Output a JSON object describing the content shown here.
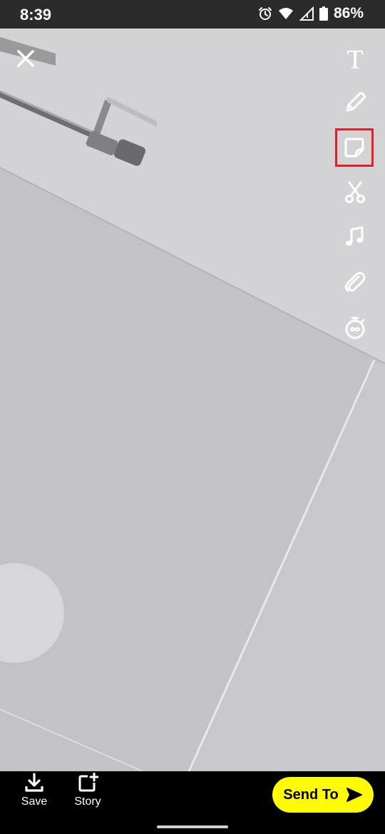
{
  "status_bar": {
    "time": "8:39",
    "battery_percent": "86%",
    "icons": [
      "alarm-icon",
      "wifi-icon",
      "signal-icon",
      "battery-icon"
    ]
  },
  "editor": {
    "close_icon": "close-icon",
    "tools": [
      {
        "name": "text-tool",
        "icon": "text-icon",
        "glyph": "T",
        "highlighted": false
      },
      {
        "name": "draw-tool",
        "icon": "pencil-icon",
        "highlighted": false
      },
      {
        "name": "sticker-tool",
        "icon": "sticker-icon",
        "highlighted": true
      },
      {
        "name": "scissors-tool",
        "icon": "scissors-icon",
        "highlighted": false
      },
      {
        "name": "music-tool",
        "icon": "music-note-icon",
        "highlighted": false
      },
      {
        "name": "attachment-tool",
        "icon": "paperclip-icon",
        "highlighted": false
      },
      {
        "name": "timer-tool",
        "icon": "timer-icon",
        "highlighted": false
      }
    ],
    "highlight_color": "#e3202a"
  },
  "bottom_bar": {
    "save_label": "Save",
    "story_label": "Story",
    "send_label": "Send To",
    "send_color": "#fffc00"
  }
}
